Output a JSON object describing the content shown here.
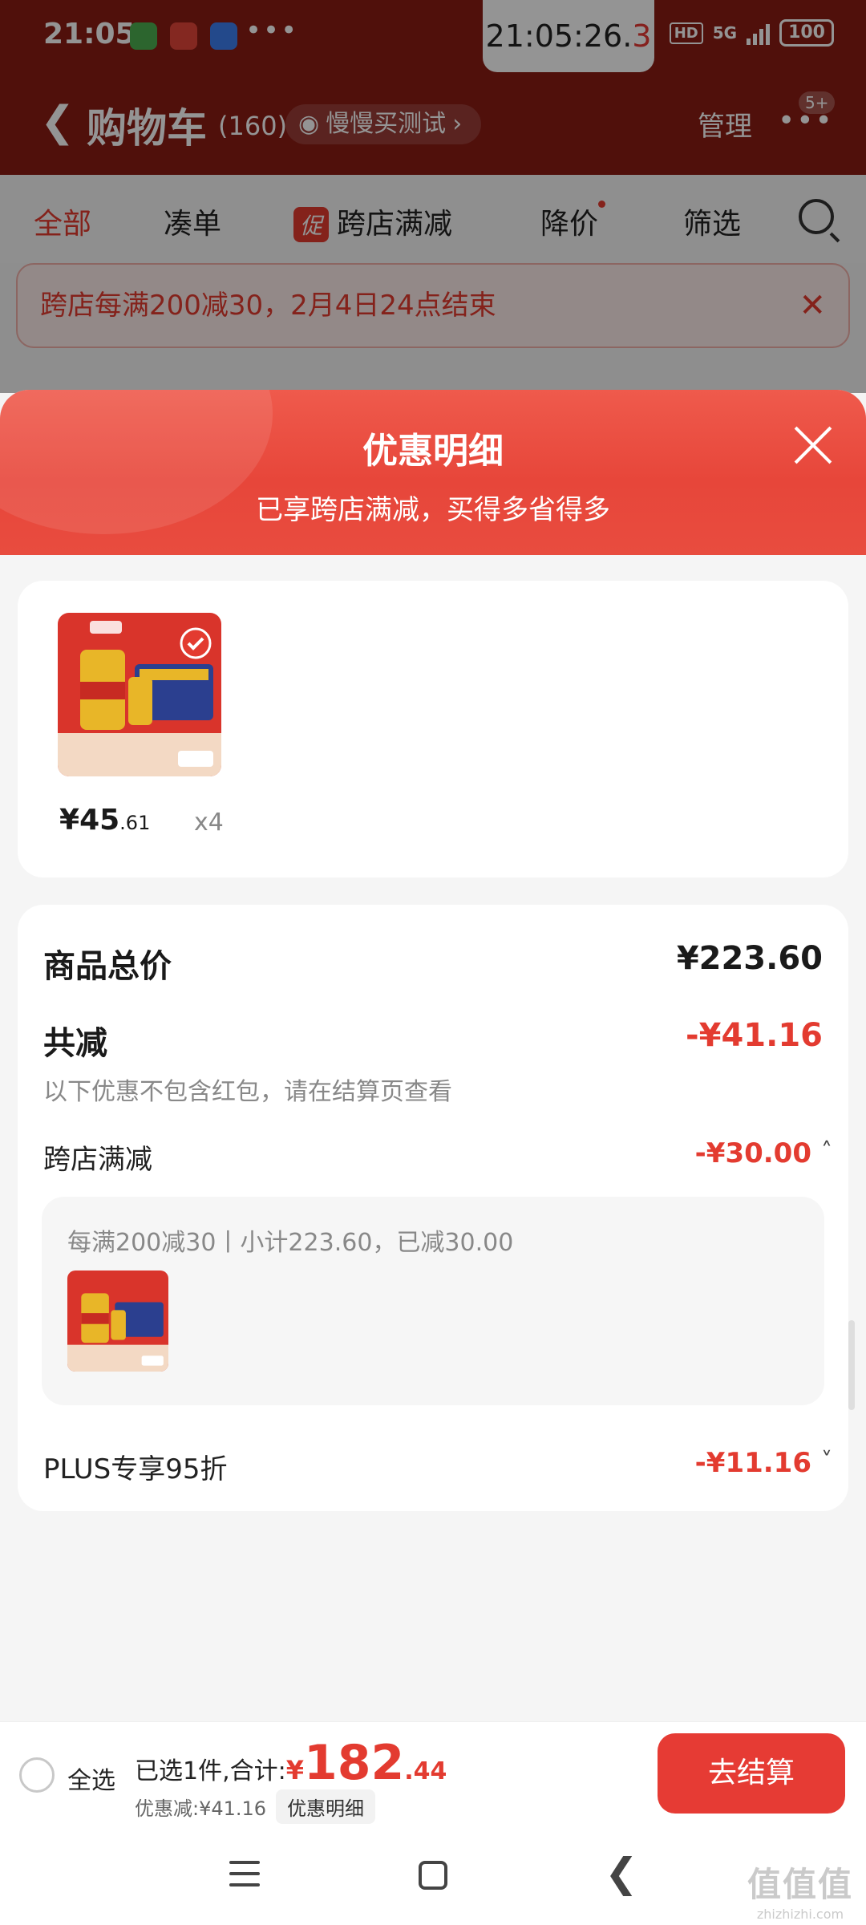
{
  "status_bar": {
    "time": "21:05",
    "clock_main": "21:05:26.",
    "clock_frac": "3",
    "more": "•••",
    "hd": "HD",
    "network": "5G",
    "battery": "100"
  },
  "nav": {
    "back_icon": "chevron-left-icon",
    "title": "购物车",
    "count": "(160)",
    "pill_label": "慢慢买测试",
    "pill_chevron": "›",
    "manage": "管理",
    "more": "•••",
    "badge": "5+"
  },
  "tabs": {
    "all": "全部",
    "bundle": "凑单",
    "promo_badge": "促",
    "cross_store": "跨店满减",
    "price_drop": "降价",
    "filter": "筛选"
  },
  "notice": {
    "text": "跨店每满200减30，2月4日24点结束",
    "close": "✕"
  },
  "sheet": {
    "title": "优惠明细",
    "subtitle": "已享跨店满减，买得多省得多"
  },
  "product": {
    "price_currency": "¥",
    "price_int": "45",
    "price_dec": ".61",
    "qty": "x4"
  },
  "summary": {
    "total_label": "商品总价",
    "total_value": "¥223.60",
    "discount_label": "共减",
    "discount_value": "-¥41.16",
    "discount_hint": "以下优惠不包含红包，请在结算页查看",
    "cross_label": "跨店满减",
    "cross_value": "-¥30.00",
    "cross_chevron": "˄",
    "cross_rule": "每满200减30丨小计223.60，已减30.00",
    "plus_label": "PLUS专享95折",
    "plus_value": "-¥11.16",
    "plus_chevron": "˅"
  },
  "bottom": {
    "select_all": "全选",
    "selected_text": "已选1件,合计:",
    "currency": "¥",
    "total_int": "182",
    "total_dec": ".44",
    "discount_text": "优惠减:¥41.16",
    "discount_chip": "优惠明细",
    "checkout": "去结算"
  },
  "watermark": {
    "big": "值值值",
    "small": "zhizhizhi.com"
  },
  "colors": {
    "accent": "#e33b30",
    "header_dark": "#8a1c14",
    "sheet_header": "#e84c3f"
  }
}
